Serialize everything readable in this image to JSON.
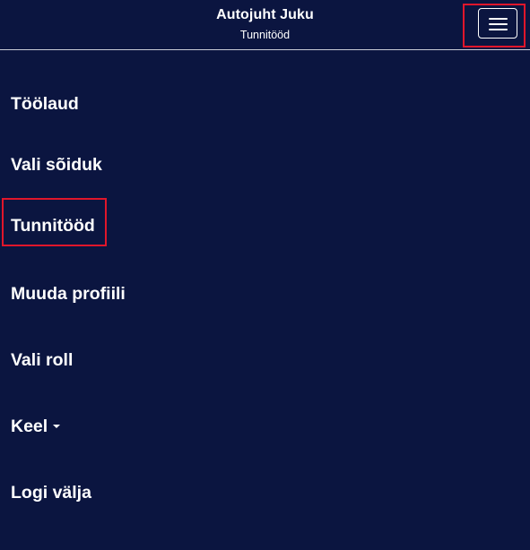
{
  "header": {
    "title": "Autojuht Juku",
    "subtitle": "Tunnitööd"
  },
  "menu_button": {
    "icon": "hamburger-menu-icon"
  },
  "nav": {
    "items": [
      {
        "label": "Töölaud"
      },
      {
        "label": "Vali sõiduk"
      },
      {
        "label": "Tunnitööd"
      },
      {
        "label": "Muuda profiili"
      },
      {
        "label": "Vali roll"
      },
      {
        "label": "Keel"
      },
      {
        "label": "Logi välja"
      }
    ]
  },
  "colors": {
    "background": "#0b1540",
    "text": "#ffffff",
    "highlight": "#e0162b"
  }
}
